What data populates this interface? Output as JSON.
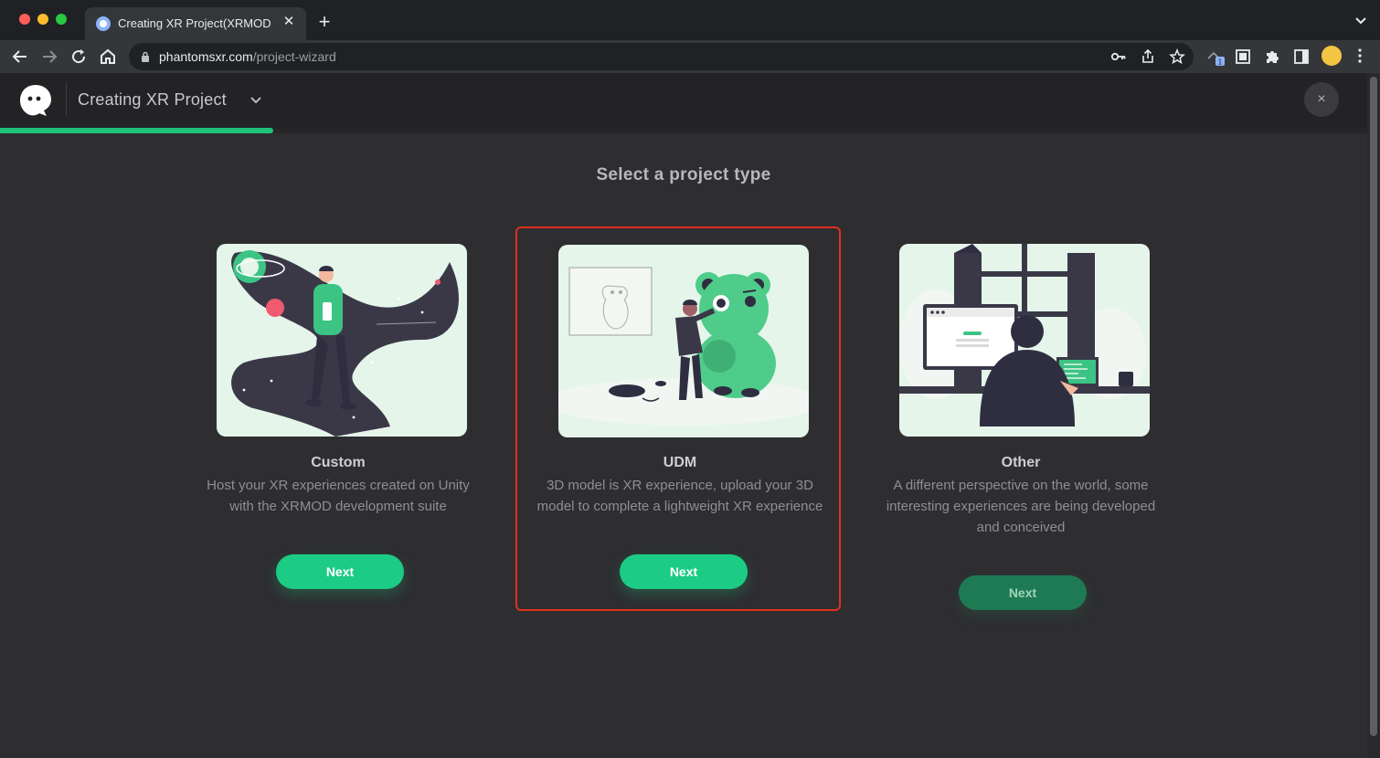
{
  "browser": {
    "tab_title": "Creating XR Project(XRMOD Cl",
    "url_host": "phantomsxr.com",
    "url_path": "/project-wizard",
    "extension_badge": "1"
  },
  "header": {
    "project_title": "Creating XR Project",
    "close_symbol": "×",
    "progress": 0.2
  },
  "main": {
    "heading": "Select a project type",
    "cards": [
      {
        "title": "Custom",
        "description": "Host your XR experiences created on Unity with the XRMOD development suite",
        "button": "Next",
        "illustration": "person-holding-phone-space-path"
      },
      {
        "title": "UDM",
        "description": "3D model is XR experience, upload your 3D model to complete a lightweight XR experience",
        "button": "Next",
        "illustration": "person-touching-green-bear-model"
      },
      {
        "title": "Other",
        "description": "A different perspective on the world, some interesting experiences are being developed and conceived",
        "button": "Next",
        "illustration": "person-at-computer-desk"
      }
    ]
  },
  "colors": {
    "accent": "#1ccc84",
    "selected_border": "#e0301e",
    "illustration_bg": "#e5f5ea",
    "page_bg": "#2e2e31"
  }
}
